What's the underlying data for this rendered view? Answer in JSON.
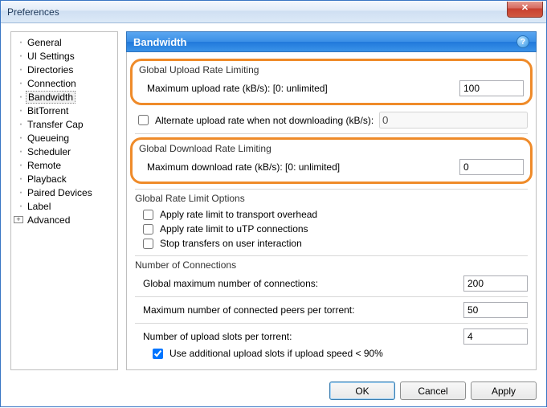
{
  "window": {
    "title": "Preferences",
    "close_label": "X"
  },
  "sidebar": {
    "items": [
      {
        "label": "General",
        "mark": "dot"
      },
      {
        "label": "UI Settings",
        "mark": "dot"
      },
      {
        "label": "Directories",
        "mark": "dot"
      },
      {
        "label": "Connection",
        "mark": "dot"
      },
      {
        "label": "Bandwidth",
        "mark": "dot",
        "selected": true
      },
      {
        "label": "BitTorrent",
        "mark": "dot"
      },
      {
        "label": "Transfer Cap",
        "mark": "dot"
      },
      {
        "label": "Queueing",
        "mark": "dot"
      },
      {
        "label": "Scheduler",
        "mark": "dot"
      },
      {
        "label": "Remote",
        "mark": "dot"
      },
      {
        "label": "Playback",
        "mark": "dot"
      },
      {
        "label": "Paired Devices",
        "mark": "dot"
      },
      {
        "label": "Label",
        "mark": "dot"
      },
      {
        "label": "Advanced",
        "mark": "plus"
      }
    ]
  },
  "panel": {
    "title": "Bandwidth",
    "help": "?",
    "upload": {
      "group_title": "Global Upload Rate Limiting",
      "max_label": "Maximum upload rate (kB/s): [0: unlimited]",
      "max_value": "100",
      "alt_checked": false,
      "alt_label": "Alternate upload rate when not downloading (kB/s):",
      "alt_value": "0"
    },
    "download": {
      "group_title": "Global Download Rate Limiting",
      "max_label": "Maximum download rate (kB/s): [0: unlimited]",
      "max_value": "0"
    },
    "options": {
      "group_title": "Global Rate Limit Options",
      "opt1_checked": false,
      "opt1_label": "Apply rate limit to transport overhead",
      "opt2_checked": false,
      "opt2_label": "Apply rate limit to uTP connections",
      "opt3_checked": false,
      "opt3_label": "Stop transfers on user interaction"
    },
    "connections": {
      "group_title": "Number of Connections",
      "global_label": "Global maximum number of connections:",
      "global_value": "200",
      "peers_label": "Maximum number of connected peers per torrent:",
      "peers_value": "50",
      "slots_label": "Number of upload slots per torrent:",
      "slots_value": "4",
      "extra_checked": true,
      "extra_label": "Use additional upload slots if upload speed < 90%"
    }
  },
  "buttons": {
    "ok": "OK",
    "cancel": "Cancel",
    "apply": "Apply"
  }
}
